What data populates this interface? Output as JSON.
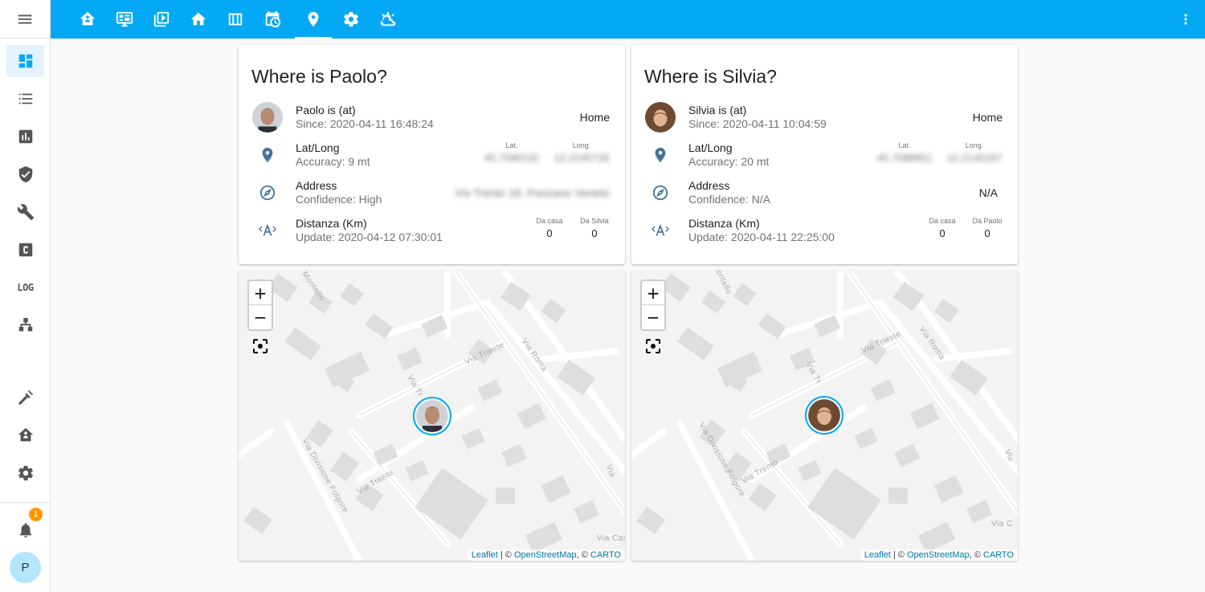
{
  "colors": {
    "accent": "#03a9f4",
    "icon": "#44739e",
    "badge": "#ff9800"
  },
  "sidebar": {
    "log_label": "LOG",
    "notification_count": "1",
    "user_initial": "P"
  },
  "cards": [
    {
      "title": "Where is Paolo?",
      "person": {
        "name": "Paolo is (at)",
        "since": "Since: 2020-04-11 16:48:24",
        "state": "Home"
      },
      "latlong": {
        "name": "Lat/Long",
        "sub": "Accuracy: 9 mt",
        "lat_label": "Lat.",
        "lat_value": "45.7090132",
        "long_label": "Long.",
        "long_value": "12.2145728"
      },
      "address": {
        "name": "Address",
        "sub": "Confidence: High",
        "state": "Via Trento 18, Ponzano Veneto"
      },
      "distance": {
        "name": "Distanza (Km)",
        "sub": "Update: 2020-04-12 07:30:01",
        "a_label": "Da casa",
        "a_value": "0",
        "b_label": "Da Silvia",
        "b_value": "0"
      }
    },
    {
      "title": "Where is Silvia?",
      "person": {
        "name": "Silvia is (at)",
        "since": "Since: 2020-04-11 10:04:59",
        "state": "Home"
      },
      "latlong": {
        "name": "Lat/Long",
        "sub": "Accuracy: 20 mt",
        "lat_label": "Lat.",
        "lat_value": "45.7088851",
        "long_label": "Long.",
        "long_value": "12.2145167"
      },
      "address": {
        "name": "Address",
        "sub": "Confidence: N/A",
        "state": "N/A"
      },
      "distance": {
        "name": "Distanza (Km)",
        "sub": "Update: 2020-04-11 22:25:00",
        "a_label": "Da casa",
        "a_value": "0",
        "b_label": "Da Paolo",
        "b_value": "0"
      }
    }
  ],
  "map": {
    "zoom_in": "+",
    "zoom_out": "−",
    "attribution_leaflet": "Leaflet",
    "attribution_sep1": " | © ",
    "attribution_osm": "OpenStreetMap",
    "attribution_sep2": ", © ",
    "attribution_carto": "CARTO",
    "streets": {
      "montello": "Montello",
      "trieste": "Via Trieste",
      "roma": "Via Roma",
      "tr": "Via Tr",
      "divisione": "Via Divisione Folgore",
      "trento": "Via Trento",
      "vicas": "Via Cas",
      "vi": "Via",
      "vic": "Via C",
      "vie": "Vie"
    }
  }
}
